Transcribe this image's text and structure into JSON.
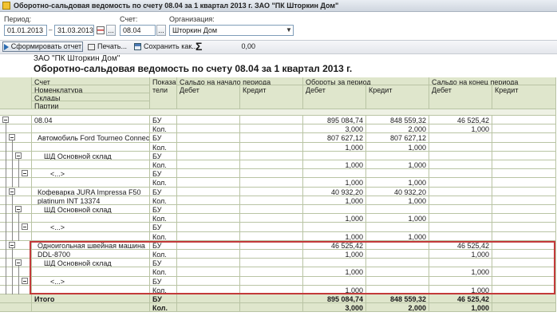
{
  "window": {
    "title": "Оборотно-сальдовая ведомость по счету 08.04 за 1 квартал 2013 г. ЗАО \"ПК Шторкин Дом\""
  },
  "filters": {
    "period_label": "Период:",
    "date_from": "01.01.2013",
    "date_to": "31.03.2013",
    "dash": "–",
    "more_button": "...",
    "account_label": "Счет:",
    "account_value": "08.04",
    "org_label": "Организация:",
    "org_value": "Шторкин Дом",
    "ellipsis": "..."
  },
  "toolbar": {
    "build_label": "Сформировать отчет",
    "print_label": "Печать...",
    "save_label": "Сохранить как...",
    "sigma": "Σ",
    "sum_value": "0,00"
  },
  "report": {
    "organization": "ЗАО \"ПК Шторкин Дом\"",
    "title": "Оборотно-сальдовая ведомость по счету 08.04 за 1 квартал 2013 г.",
    "headers": {
      "account": "Счет",
      "nomenclature": "Номенклатура",
      "warehouses": "Склады",
      "batches": "Партии",
      "indicators": "Показа\nтели",
      "opening": "Сальдо на начало периода",
      "turnover": "Обороты за период",
      "closing": "Сальдо на конец периода",
      "debit": "Дебет",
      "credit": "Кредит"
    },
    "rows": [
      {
        "label": "08.04",
        "ind": "БУ",
        "od": "",
        "oc": "",
        "td": "895 084,74",
        "tc": "848 559,32",
        "cd": "46 525,42",
        "cc": "",
        "indent": 0
      },
      {
        "label": "",
        "ind": "Кол.",
        "od": "",
        "oc": "",
        "td": "3,000",
        "tc": "2,000",
        "cd": "1,000",
        "cc": "",
        "indent": 0
      },
      {
        "label": "Автомобиль Ford Tourneo Connect",
        "ind": "БУ",
        "od": "",
        "oc": "",
        "td": "807 627,12",
        "tc": "807 627,12",
        "cd": "",
        "cc": "",
        "indent": 1
      },
      {
        "label": "",
        "ind": "Кол.",
        "od": "",
        "oc": "",
        "td": "1,000",
        "tc": "1,000",
        "cd": "",
        "cc": "",
        "indent": 1
      },
      {
        "label": "ШД Основной склад",
        "ind": "БУ",
        "od": "",
        "oc": "",
        "td": "",
        "tc": "",
        "cd": "",
        "cc": "",
        "indent": 2
      },
      {
        "label": "",
        "ind": "Кол.",
        "od": "",
        "oc": "",
        "td": "1,000",
        "tc": "1,000",
        "cd": "",
        "cc": "",
        "indent": 2
      },
      {
        "label": "<...>",
        "ind": "БУ",
        "od": "",
        "oc": "",
        "td": "",
        "tc": "",
        "cd": "",
        "cc": "",
        "indent": 3
      },
      {
        "label": "",
        "ind": "Кол.",
        "od": "",
        "oc": "",
        "td": "1,000",
        "tc": "1,000",
        "cd": "",
        "cc": "",
        "indent": 3
      },
      {
        "label": "Кофеварка JURA Impressa F50",
        "ind": "БУ",
        "od": "",
        "oc": "",
        "td": "40 932,20",
        "tc": "40 932,20",
        "cd": "",
        "cc": "",
        "indent": 1
      },
      {
        "label": "platinum INT 13374",
        "ind": "Кол.",
        "od": "",
        "oc": "",
        "td": "1,000",
        "tc": "1,000",
        "cd": "",
        "cc": "",
        "indent": 1
      },
      {
        "label": "ШД Основной склад",
        "ind": "БУ",
        "od": "",
        "oc": "",
        "td": "",
        "tc": "",
        "cd": "",
        "cc": "",
        "indent": 2
      },
      {
        "label": "",
        "ind": "Кол.",
        "od": "",
        "oc": "",
        "td": "1,000",
        "tc": "1,000",
        "cd": "",
        "cc": "",
        "indent": 2
      },
      {
        "label": "<...>",
        "ind": "БУ",
        "od": "",
        "oc": "",
        "td": "",
        "tc": "",
        "cd": "",
        "cc": "",
        "indent": 3
      },
      {
        "label": "",
        "ind": "Кол.",
        "od": "",
        "oc": "",
        "td": "1,000",
        "tc": "1,000",
        "cd": "",
        "cc": "",
        "indent": 3
      },
      {
        "label": "Одноигольная швейная машина",
        "ind": "БУ",
        "od": "",
        "oc": "",
        "td": "46 525,42",
        "tc": "",
        "cd": "46 525,42",
        "cc": "",
        "indent": 1
      },
      {
        "label": "DDL-8700",
        "ind": "Кол.",
        "od": "",
        "oc": "",
        "td": "1,000",
        "tc": "",
        "cd": "1,000",
        "cc": "",
        "indent": 1
      },
      {
        "label": "ШД Основной склад",
        "ind": "БУ",
        "od": "",
        "oc": "",
        "td": "",
        "tc": "",
        "cd": "",
        "cc": "",
        "indent": 2
      },
      {
        "label": "",
        "ind": "Кол.",
        "od": "",
        "oc": "",
        "td": "1,000",
        "tc": "",
        "cd": "1,000",
        "cc": "",
        "indent": 2
      },
      {
        "label": "<...>",
        "ind": "БУ",
        "od": "",
        "oc": "",
        "td": "",
        "tc": "",
        "cd": "",
        "cc": "",
        "indent": 3
      },
      {
        "label": "",
        "ind": "Кол.",
        "od": "",
        "oc": "",
        "td": "1,000",
        "tc": "",
        "cd": "1,000",
        "cc": "",
        "indent": 3
      }
    ],
    "total": [
      {
        "label": "Итого",
        "ind": "БУ",
        "td": "895 084,74",
        "tc": "848 559,32",
        "cd": "46 525,42"
      },
      {
        "label": "",
        "ind": "Кол.",
        "td": "3,000",
        "tc": "2,000",
        "cd": "1,000"
      }
    ]
  },
  "colors": {
    "header_bg": "#dfe6cc",
    "grid_line": "#b9c4a4",
    "highlight": "#c33a3a"
  }
}
